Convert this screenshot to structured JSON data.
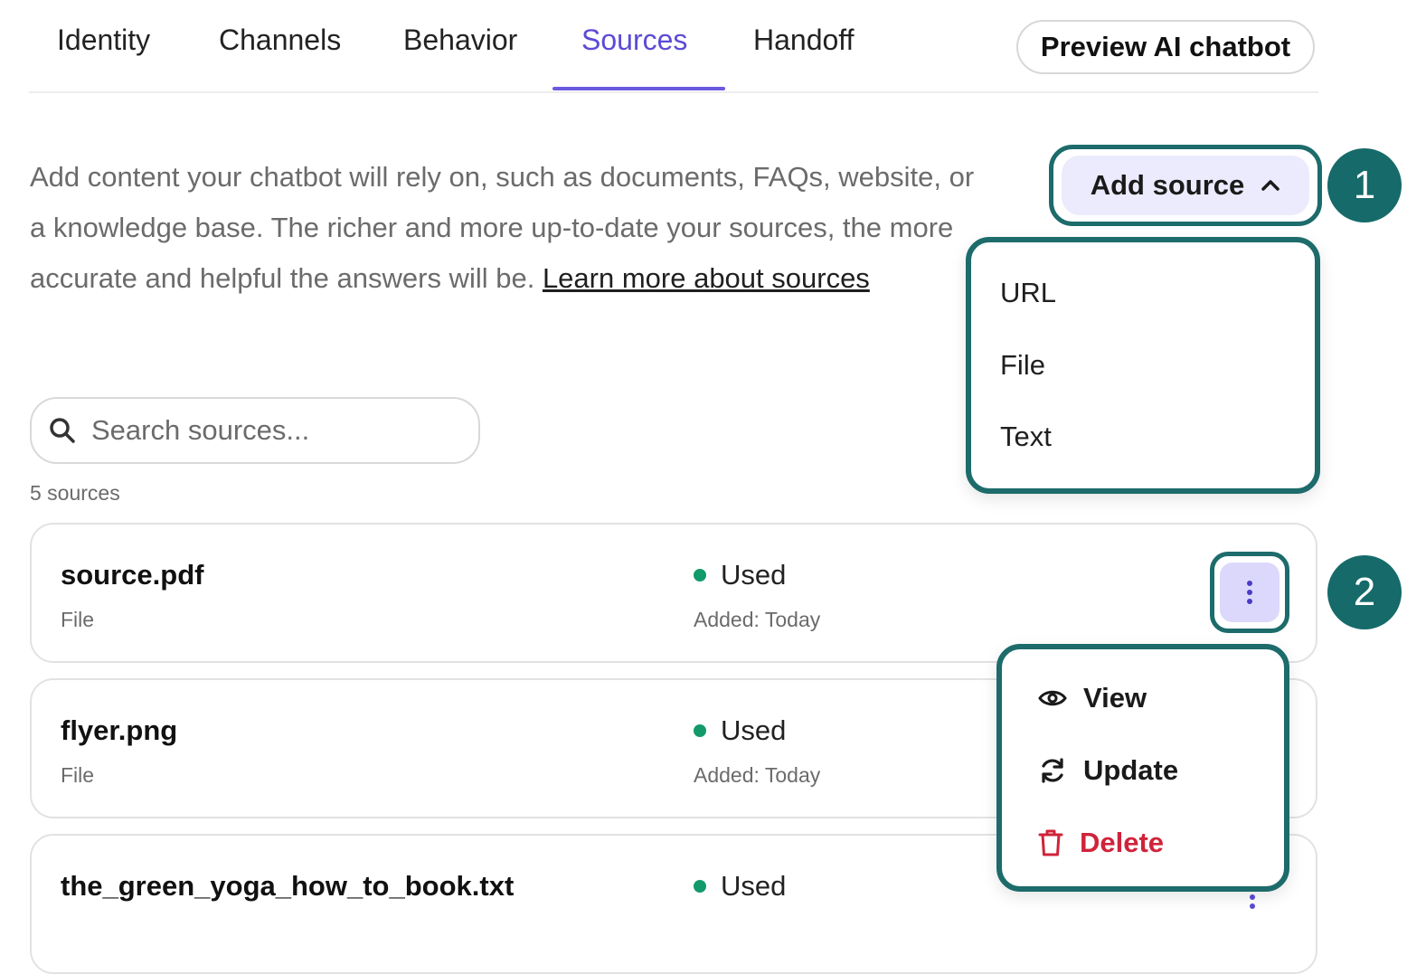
{
  "tabs": [
    {
      "label": "Identity"
    },
    {
      "label": "Channels"
    },
    {
      "label": "Behavior"
    },
    {
      "label": "Sources"
    },
    {
      "label": "Handoff"
    }
  ],
  "active_tab": "Sources",
  "preview_button": "Preview AI chatbot",
  "description": {
    "text": "Add content your chatbot will rely on, such as documents, FAQs, website, or a knowledge base. The richer and more up-to-date your sources, the more accurate and helpful the answers will be. ",
    "link": "Learn more about sources"
  },
  "add_source": {
    "label": "Add source",
    "menu": [
      "URL",
      "File",
      "Text"
    ]
  },
  "callouts": [
    "1",
    "2"
  ],
  "search": {
    "placeholder": "Search sources..."
  },
  "count_label": "5 sources",
  "sources": [
    {
      "name": "source.pdf",
      "type": "File",
      "status": "Used",
      "added": "Added: Today"
    },
    {
      "name": "flyer.png",
      "type": "File",
      "status": "Used",
      "added": "Added: Today"
    },
    {
      "name": "the_green_yoga_how_to_book.txt",
      "type": "",
      "status": "Used",
      "added": ""
    }
  ],
  "row_menu": [
    {
      "label": "View",
      "icon": "eye-icon"
    },
    {
      "label": "Update",
      "icon": "refresh-icon"
    },
    {
      "label": "Delete",
      "icon": "trash-icon"
    }
  ],
  "colors": {
    "accent": "#5b4bd6",
    "highlight": "#1d6b6b",
    "status_dot": "#129a6a",
    "danger": "#d0233a"
  }
}
